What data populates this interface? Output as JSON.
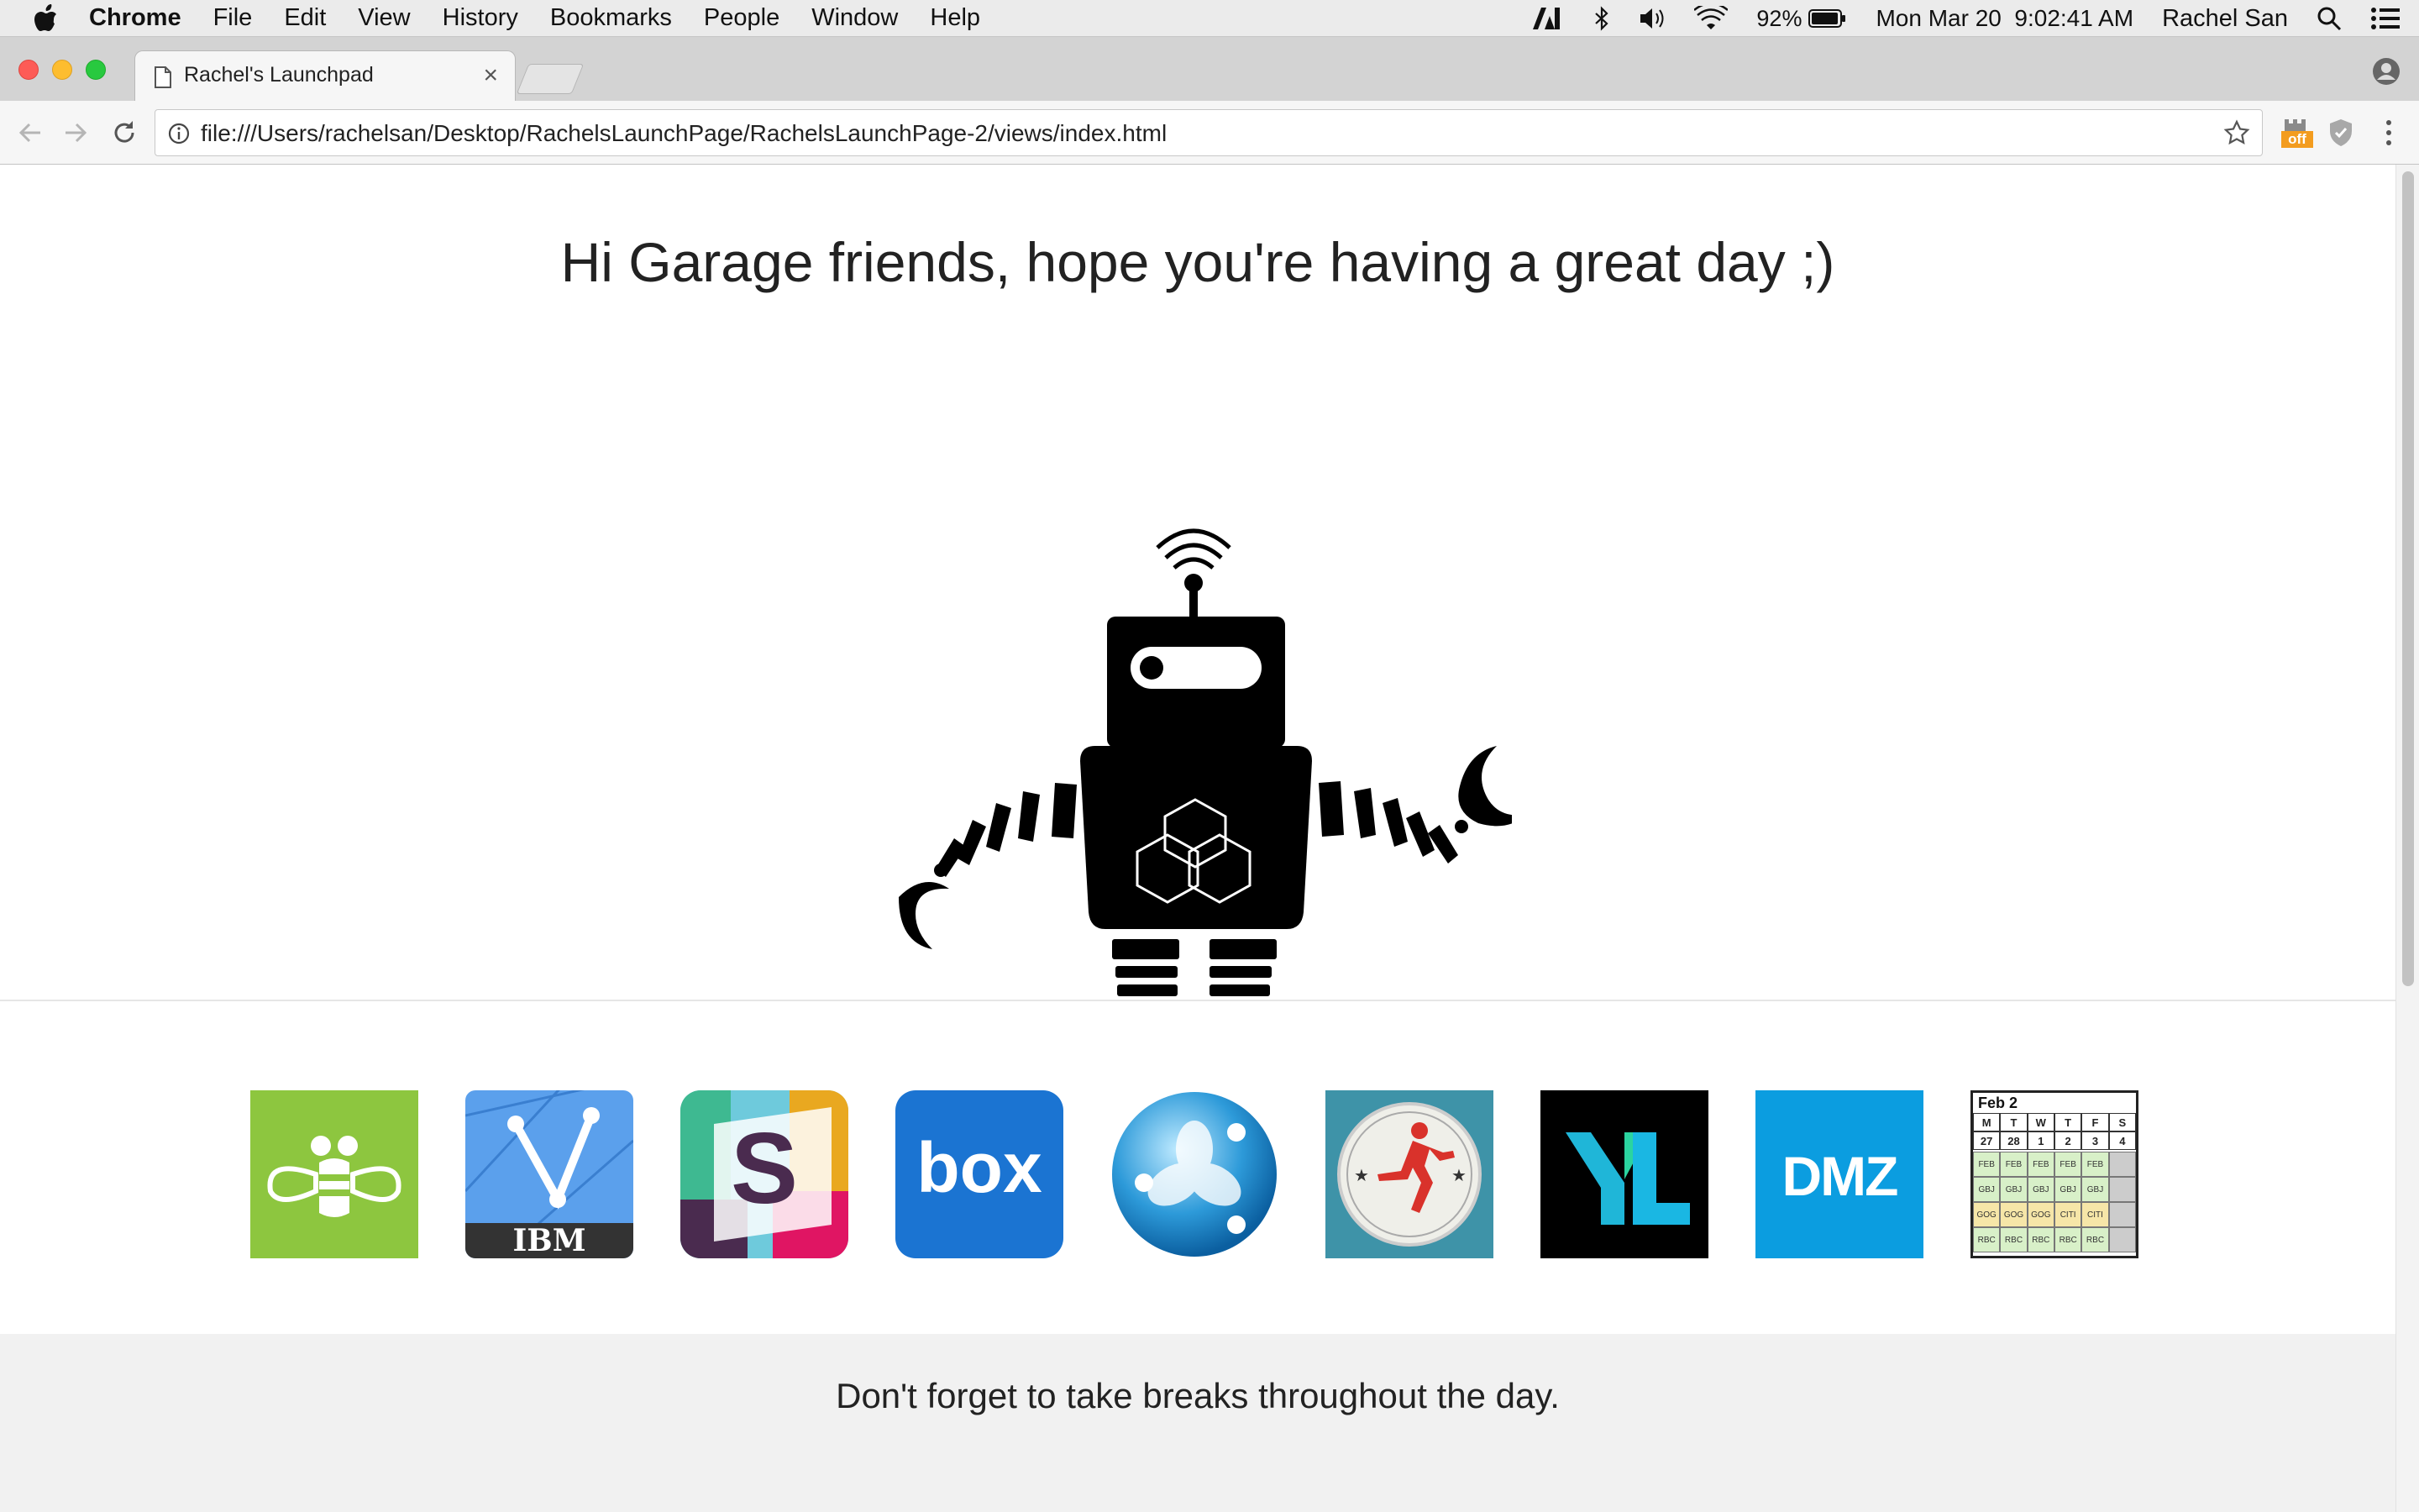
{
  "menubar": {
    "app_name": "Chrome",
    "items": [
      "File",
      "Edit",
      "View",
      "History",
      "Bookmarks",
      "People",
      "Window",
      "Help"
    ],
    "battery": "92%",
    "datetime": "Mon Mar 20  9:02:41 AM",
    "user": "Rachel San"
  },
  "tab": {
    "title": "Rachel's Launchpad"
  },
  "omnibox": {
    "url": "file:///Users/rachelsan/Desktop/RachelsLaunchPage/RachelsLaunchPage-2/views/index.html"
  },
  "extension_badge": "off",
  "page": {
    "greeting": "Hi Garage friends, hope you're having a great day ;)",
    "footer_message": "Don't forget to take breaks throughout the day."
  },
  "apps": [
    {
      "icon": "bee-app-icon",
      "bg": "#8dc63f"
    },
    {
      "icon": "ibm-app-icon",
      "label": "IBM",
      "bg": "#5ba0ec"
    },
    {
      "icon": "slack-app-icon",
      "label": "S"
    },
    {
      "icon": "box-app-icon",
      "label": "box",
      "bg": "#1b74d2"
    },
    {
      "icon": "sphere-app-icon",
      "bg": "#2d9ad9"
    },
    {
      "icon": "runner-app-icon",
      "bg": "#3e93a8"
    },
    {
      "icon": "yl-app-icon",
      "label": "YL",
      "bg": "#000000"
    },
    {
      "icon": "dmz-app-icon",
      "label": "DMZ",
      "bg": "#0b9de0"
    },
    {
      "icon": "calendar-app-icon",
      "label": "Feb 2",
      "days": [
        "M",
        "T",
        "W",
        "T",
        "F",
        "S"
      ],
      "dates": [
        "27",
        "28",
        "1",
        "2",
        "3",
        "4"
      ],
      "rows": [
        [
          "FEB",
          "FEB",
          "FEB",
          "FEB",
          "FEB"
        ],
        [
          "GBJ",
          "GBJ",
          "GBJ",
          "GBJ",
          "GBJ"
        ],
        [
          "GOG",
          "GOG",
          "GOG",
          "CITI",
          "CITI"
        ],
        [
          "RBC",
          "RBC",
          "RBC",
          "RBC",
          "RBC"
        ]
      ]
    }
  ]
}
